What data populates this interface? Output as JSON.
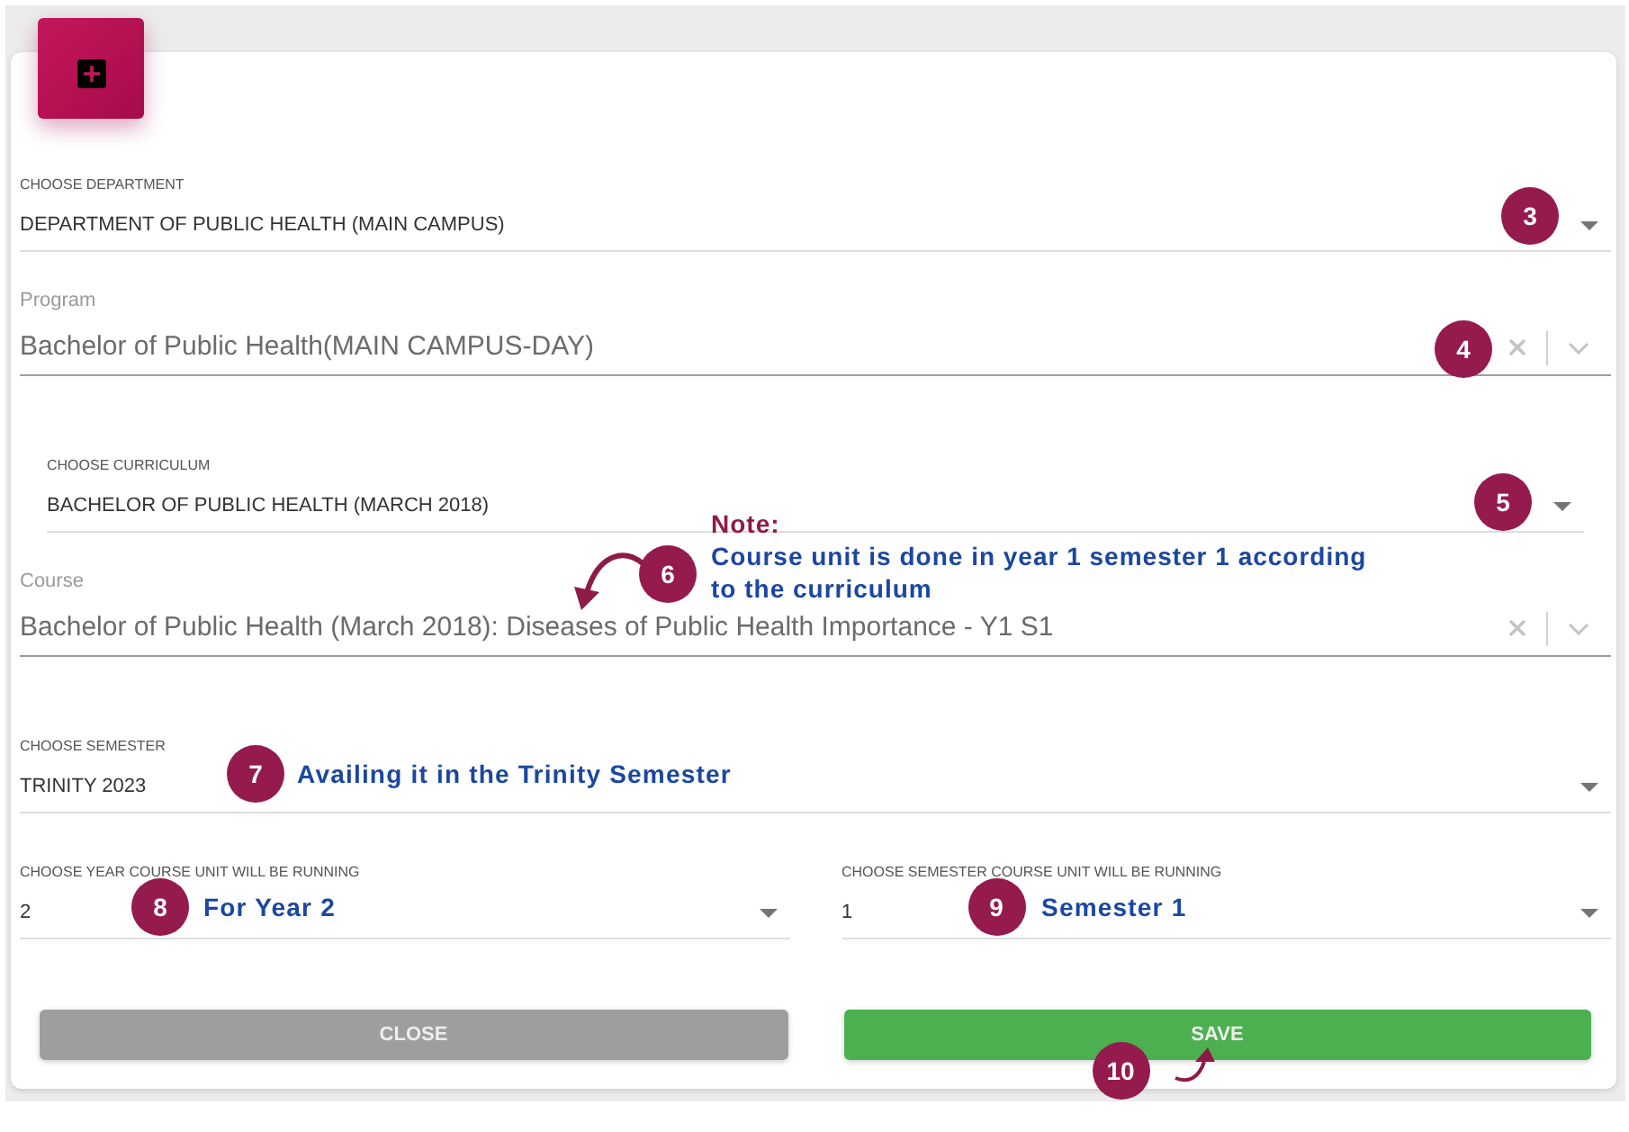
{
  "form": {
    "rows": [
      {
        "fields": [
          {
            "kind": "select",
            "label": "CHOOSE DEPARTMENT",
            "value": "DEPARTMENT OF PUBLIC HEALTH (MAIN CAMPUS)",
            "badge": {
              "number": "3",
              "arrow": false
            }
          }
        ]
      },
      {
        "fields": [
          {
            "kind": "autocomplete",
            "label": "Program",
            "value": "Bachelor of Public Health(MAIN CAMPUS-DAY)",
            "badge": {
              "number": "4",
              "arrow": false
            }
          }
        ]
      },
      {
        "fields": [
          {
            "kind": "select",
            "label": "CHOOSE CURRICULUM",
            "value": "BACHELOR OF PUBLIC HEALTH (MARCH 2018)",
            "badge": {
              "number": "5",
              "arrow": false
            }
          }
        ]
      },
      {
        "fields": [
          {
            "kind": "autocomplete",
            "label": "Course",
            "value": "Bachelor of Public Health (March 2018): Diseases of Public Health Importance - Y1 S1",
            "badge": {
              "number": "6",
              "arrow": true
            },
            "note": {
              "title": "Note:",
              "text": "Course unit is done in year 1 semester 1 according to the curriculum"
            }
          }
        ]
      },
      {
        "fields": [
          {
            "kind": "select",
            "label": "CHOOSE SEMESTER",
            "value": "TRINITY 2023",
            "badge": {
              "number": "7",
              "arrow": false
            },
            "note": {
              "text": "Availing it in the Trinity Semester"
            }
          }
        ]
      },
      {
        "fields": [
          {
            "kind": "select",
            "label": "CHOOSE YEAR COURSE UNIT WILL BE RUNNING",
            "value": "2",
            "badge": {
              "number": "8",
              "arrow": false
            },
            "note": {
              "text": "For Year 2"
            }
          },
          {
            "kind": "select",
            "label": "CHOOSE SEMESTER COURSE UNIT WILL BE RUNNING",
            "value": "1",
            "badge": {
              "number": "9",
              "arrow": false
            },
            "note": {
              "text": "Semester 1"
            }
          }
        ]
      }
    ]
  },
  "buttons": [
    {
      "kind": "close",
      "label": "CLOSE"
    },
    {
      "kind": "save",
      "label": "SAVE",
      "badge": {
        "number": "10",
        "arrow": true
      }
    }
  ]
}
